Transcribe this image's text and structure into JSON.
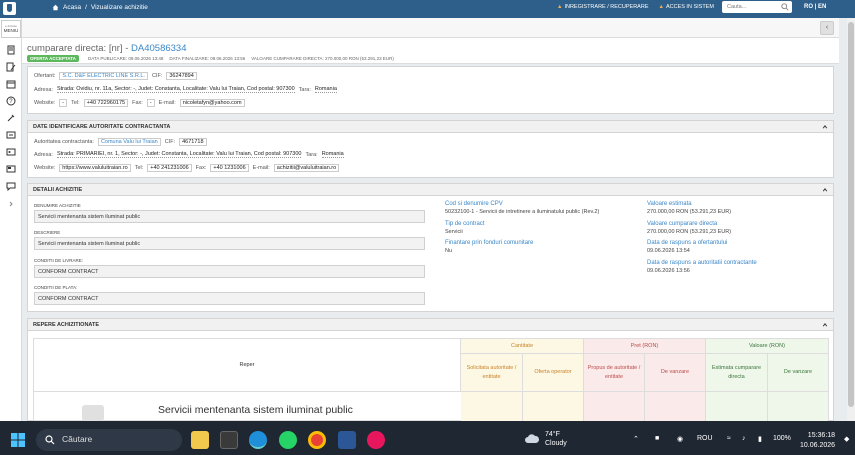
{
  "topbar": {
    "breadcrumb_home": "Acasa",
    "breadcrumb_sep": "/",
    "breadcrumb_current": "Vizualizare achizitie",
    "link_register": "INREGISTRARE / RECUPERARE",
    "link_access": "ACCES IN SISTEM",
    "search_placeholder": "Cauta...",
    "lang": "RO | EN"
  },
  "sidebar": {
    "menu_label": "MENIU",
    "menu_small": "e-licitatie"
  },
  "header": {
    "title_prefix": "cumparare directa: [nr] - ",
    "title_code": "DA40586334",
    "badge": "OFERTA ACCEPTATA",
    "meta_published": "DATA PUBLICARE: 09.06.2026 13:48",
    "meta_final": "DATA FINALIZARE: 09.06.2026 13:56",
    "meta_value": "VALOARE CUMPARARE DIRECTA: 270.000,00 RON (53.291,23 EUR)"
  },
  "offerer": {
    "label": "Ofertant:",
    "name": "S.C. D&F ELECTRIC LINE S.R.L.",
    "cif_label": "CIF:",
    "cif": "36247894",
    "address_label": "Adresa:",
    "address": "Strada: Ovidiu, nr. 11a, Sector: -, Judet: Constanta, Localitate: Valu lui Traian, Cod postal: 907300",
    "country_label": "Tara:",
    "country": "Romania",
    "website_label": "Website:",
    "website": "-",
    "tel_label": "Tel:",
    "tel": "+40 722960175",
    "fax_label": "Fax:",
    "fax": "-",
    "email_label": "E-mail:",
    "email": "nicoletafyn@yahoo.com"
  },
  "authority": {
    "section_title": "DATE IDENTIFICARE AUTORITATE CONTRACTANTA",
    "label": "Autoritatea contractanta:",
    "name": "Comuna Valu lui Traian",
    "cif_label": "CIF:",
    "cif": "4671718",
    "address_label": "Adresa:",
    "address": "Strada: PRIMARIEI, nr. 1, Sector: -, Judet: Constanta, Localitate: Valu lui Traian, Cod postal: 907300",
    "country_label": "Tara:",
    "country": "Romania",
    "website_label": "Website:",
    "website": "https://www.valuluitraian.ro",
    "tel_label": "Tel:",
    "tel": "+40 241231006",
    "fax_label": "Fax:",
    "fax": "+40 1231006",
    "email_label": "E-mail:",
    "email": "achizitii@valuluitraian.ro"
  },
  "details": {
    "section_title": "DETALII ACHIZITIE",
    "name_label": "DENUMIRE ACHIZITIE",
    "name": "Servicii mentenanta sistem iluminat public",
    "desc_label": "DESCRIERE",
    "desc": "Servicii mentenanta sistem iluminat public",
    "delivery_label": "CONDITII DE LIVRARE:",
    "delivery": "CONFORM CONTRACT",
    "payment_label": "CONDITII DE PLATA:",
    "payment": "CONFORM CONTRACT",
    "cpv_title": "Cod si denumire CPV",
    "cpv": "50232100-1 - Servicii de intretinere a iluminatului public (Rev.2)",
    "contract_type_title": "Tip de contract",
    "contract_type": "Servicii",
    "eu_funds_title": "Finantare prin fonduri comunitare",
    "eu_funds": "Nu",
    "est_value_title": "Valoare estimata",
    "est_value": "270.000,00 RON (53.291,23 EUR)",
    "purchase_value_title": "Valoare cumparare directa",
    "purchase_value": "270.000,00 RON (53.291,23 EUR)",
    "response_date_title": "Data de raspuns a ofertantului",
    "response_date": "09.06.2026 13:54",
    "authority_response_title": "Data de raspuns a autoritatii contractante",
    "authority_response": "09.06.2026 13:56"
  },
  "items": {
    "section_title": "REPERE ACHIZITIONATE",
    "col_reper": "Reper",
    "group_qty": "Cantitate",
    "group_price": "Pret (RON)",
    "group_value": "Valoare (RON)",
    "col_qty_req": "Solicitata autoritate / entitate",
    "col_qty_offer": "Oferta operator",
    "col_price_prop": "Propus de autoritate / entitate",
    "col_price_sale": "De vanzare",
    "col_val_est": "Estimata cumparare directa",
    "col_val_sale": "De vanzare",
    "item_name": "Servicii mentenanta sistem iluminat public"
  },
  "taskbar": {
    "search": "Căutare",
    "temp": "74°F",
    "weather": "Cloudy",
    "lang": "ROU",
    "battery": "100%",
    "time": "15:36:18",
    "date": "10.06.2026"
  },
  "colors": {
    "brand": "#2e5f8a",
    "link": "#3a87c7",
    "accepted": "#5cb85c",
    "qty_bg": "#fdf8e4",
    "price_bg": "#fbeaea",
    "value_bg": "#eef7e9"
  }
}
